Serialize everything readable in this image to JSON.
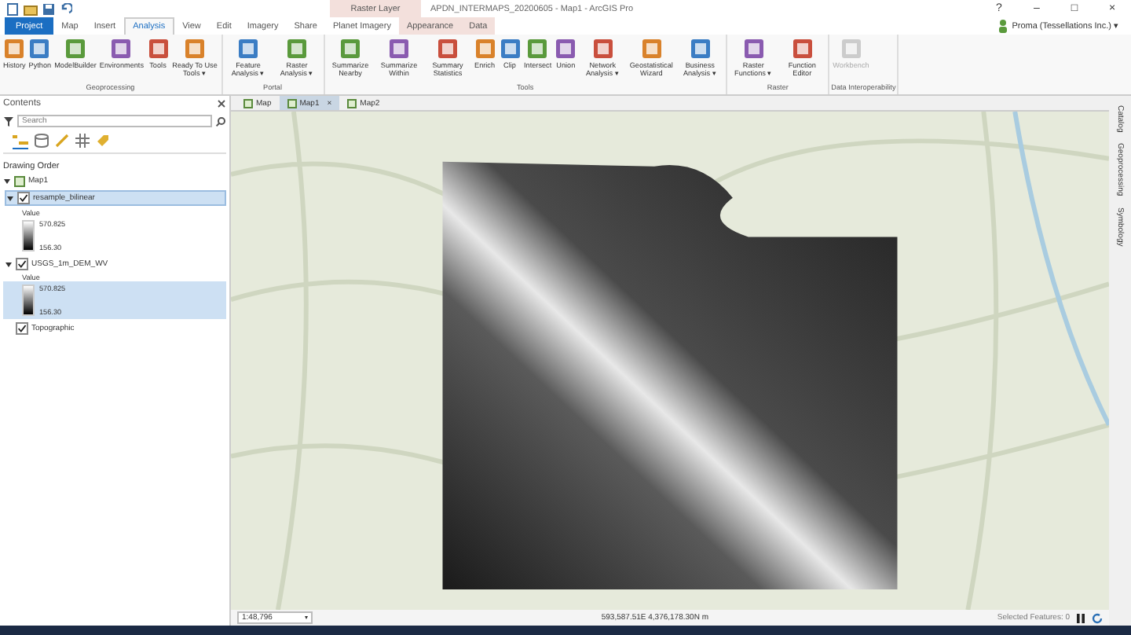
{
  "window": {
    "title": "APDN_INTERMAPS_20200605 - Map1 - ArcGIS Pro",
    "controls": [
      "?",
      "–",
      "□",
      "×"
    ]
  },
  "contextual_tab": {
    "label": "Raster Layer"
  },
  "tabs": [
    {
      "label": "Project",
      "kind": "file",
      "selected": false
    },
    {
      "label": "Map",
      "kind": "normal",
      "selected": false
    },
    {
      "label": "Insert",
      "kind": "normal",
      "selected": false
    },
    {
      "label": "Analysis",
      "kind": "normal",
      "selected": true
    },
    {
      "label": "View",
      "kind": "normal",
      "selected": false
    },
    {
      "label": "Edit",
      "kind": "normal",
      "selected": false
    },
    {
      "label": "Imagery",
      "kind": "normal",
      "selected": false
    },
    {
      "label": "Share",
      "kind": "normal",
      "selected": false
    },
    {
      "label": "Planet Imagery",
      "kind": "normal",
      "selected": false
    },
    {
      "label": "Appearance",
      "kind": "contextual",
      "selected": false
    },
    {
      "label": "Data",
      "kind": "contextual",
      "selected": false
    }
  ],
  "account": {
    "label": "Proma (Tessellations Inc.) ▾"
  },
  "ribbon": {
    "groups": [
      {
        "label": "Geoprocessing",
        "buttons": [
          {
            "label": "History",
            "disabled": false
          },
          {
            "label": "Python",
            "disabled": false
          },
          {
            "label": "ModelBuilder",
            "disabled": false
          },
          {
            "label": "Environments",
            "disabled": false
          },
          {
            "label": "Tools",
            "disabled": false
          },
          {
            "label": "Ready To Use Tools ▾",
            "disabled": false
          }
        ]
      },
      {
        "label": "Portal",
        "buttons": [
          {
            "label": "Feature Analysis ▾",
            "disabled": false
          },
          {
            "label": "Raster Analysis ▾",
            "disabled": false
          }
        ]
      },
      {
        "label": "Tools",
        "buttons": [
          {
            "label": "Summarize Nearby",
            "disabled": false
          },
          {
            "label": "Summarize Within",
            "disabled": false
          },
          {
            "label": "Summary Statistics",
            "disabled": false
          },
          {
            "label": "Enrich",
            "disabled": false
          },
          {
            "label": "Clip",
            "disabled": false
          },
          {
            "label": "Intersect",
            "disabled": false
          },
          {
            "label": "Union",
            "disabled": false
          },
          {
            "label": "Network Analysis ▾",
            "disabled": false
          },
          {
            "label": "Geostatistical Wizard",
            "disabled": false
          },
          {
            "label": "Business Analysis ▾",
            "disabled": false
          }
        ]
      },
      {
        "label": "Raster",
        "buttons": [
          {
            "label": "Raster Functions ▾",
            "disabled": false
          },
          {
            "label": "Function Editor",
            "disabled": false
          }
        ]
      },
      {
        "label": "Data Interoperability",
        "buttons": [
          {
            "label": "Workbench",
            "disabled": true
          }
        ]
      }
    ]
  },
  "contents": {
    "title": "Contents",
    "search": {
      "placeholder": "Search"
    },
    "heading": "Drawing Order",
    "tree": [
      {
        "label": "Map1",
        "kind": "map",
        "expanded": true,
        "children": [
          {
            "label": "resample_bilinear",
            "kind": "layer",
            "checked": true,
            "selected": true,
            "legend": {
              "title": "Value",
              "high": "570.825",
              "low": "156.30",
              "selected": false
            }
          },
          {
            "label": "USGS_1m_DEM_WV",
            "kind": "layer",
            "checked": true,
            "selected": false,
            "legend": {
              "title": "Value",
              "high": "570.825",
              "low": "156.30",
              "selected": true
            }
          },
          {
            "label": "Topographic",
            "kind": "basemap",
            "checked": true,
            "selected": false
          }
        ]
      }
    ]
  },
  "map_tabs": [
    {
      "label": "Map",
      "selected": false
    },
    {
      "label": "Map1",
      "selected": true,
      "close": "×"
    },
    {
      "label": "Map2",
      "selected": false
    }
  ],
  "dock_tabs": [
    "Catalog",
    "Geoprocessing",
    "Symbology"
  ],
  "status_bar": {
    "scale": "1:48,796",
    "scale_caret": "▾",
    "coordinates": "593,587.51E 4,376,178.30N m",
    "selected_features": "Selected Features: 0"
  }
}
